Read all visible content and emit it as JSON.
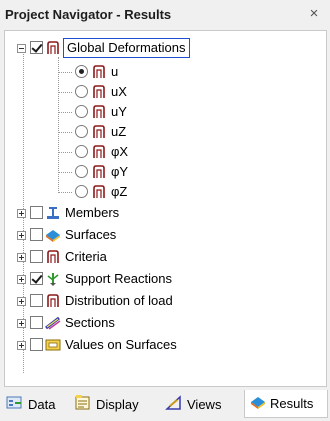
{
  "window": {
    "title": "Project Navigator - Results",
    "close_glyph": "×"
  },
  "tree": {
    "root": {
      "label": "Global Deformations",
      "checked": true,
      "expanded": true
    },
    "results": [
      {
        "label": "u",
        "selected": true
      },
      {
        "label": "uX",
        "selected": false
      },
      {
        "label": "uY",
        "selected": false
      },
      {
        "label": "uZ",
        "selected": false
      },
      {
        "label": "φX",
        "selected": false
      },
      {
        "label": "φY",
        "selected": false
      },
      {
        "label": "φZ",
        "selected": false
      }
    ],
    "groups": [
      {
        "label": "Members",
        "checked": false,
        "icon": "member-icon"
      },
      {
        "label": "Surfaces",
        "checked": false,
        "icon": "surface-icon"
      },
      {
        "label": "Criteria",
        "checked": false,
        "icon": "criteria-icon"
      },
      {
        "label": "Support Reactions",
        "checked": true,
        "icon": "support-icon"
      },
      {
        "label": "Distribution of load",
        "checked": false,
        "icon": "criteria-icon"
      },
      {
        "label": "Sections",
        "checked": false,
        "icon": "section-icon"
      },
      {
        "label": "Values on Surfaces",
        "checked": false,
        "icon": "values-icon"
      }
    ]
  },
  "tabs": [
    {
      "label": "Data",
      "icon": "data-icon",
      "active": false
    },
    {
      "label": "Display",
      "icon": "display-icon",
      "active": false
    },
    {
      "label": "Views",
      "icon": "views-icon",
      "active": false
    },
    {
      "label": "Results",
      "icon": "results-icon",
      "active": true
    }
  ],
  "colors": {
    "selection_border": "#1f4fd3",
    "frame_icon": "#8b1a1a"
  }
}
